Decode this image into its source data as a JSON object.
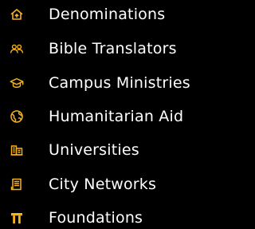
{
  "accent_color": "#f6b21a",
  "text_color": "#ffffff",
  "background_color": "#000000",
  "menu": {
    "items": [
      {
        "label": "Denominations",
        "icon": "home-icon"
      },
      {
        "label": "Bible Translators",
        "icon": "users-icon"
      },
      {
        "label": "Campus Ministries",
        "icon": "graduation-cap-icon"
      },
      {
        "label": "Humanitarian Aid",
        "icon": "globe-icon"
      },
      {
        "label": "Universities",
        "icon": "buildings-icon"
      },
      {
        "label": "City Networks",
        "icon": "receipt-icon"
      },
      {
        "label": "Foundations",
        "icon": "pillar-icon"
      }
    ]
  }
}
